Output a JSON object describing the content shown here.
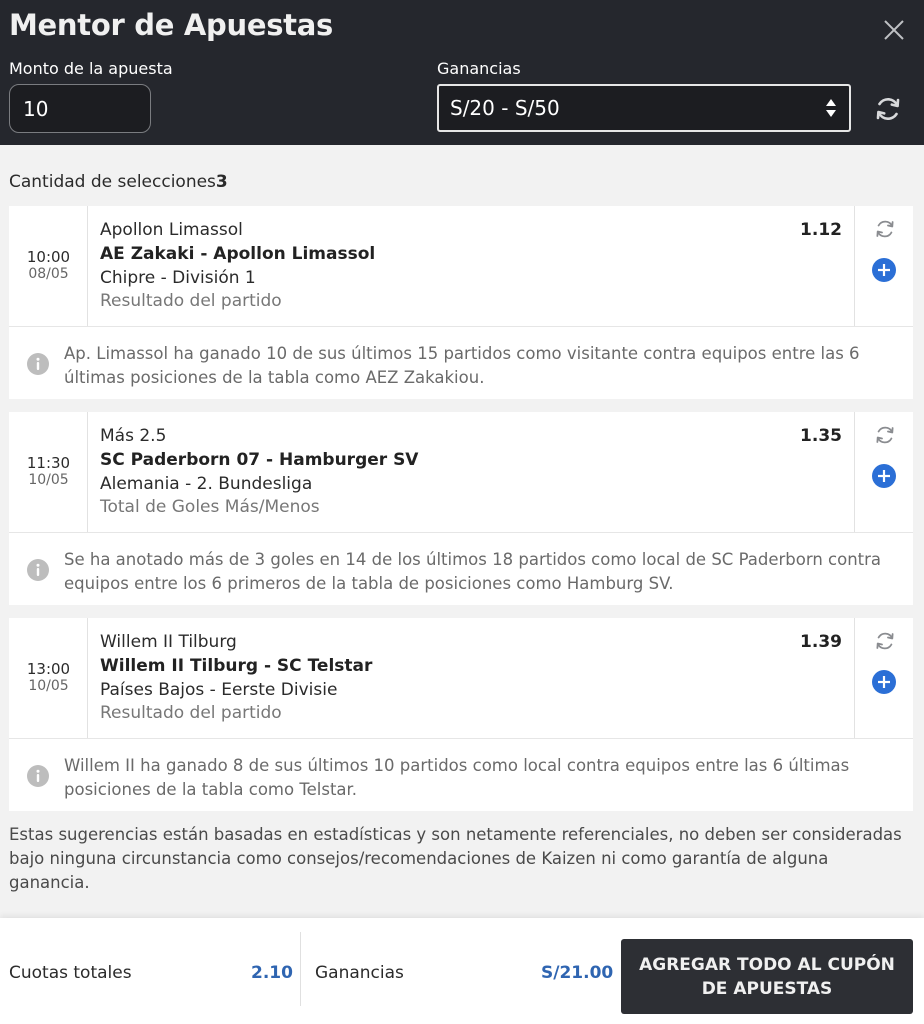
{
  "header": {
    "title": "Mentor de Apuestas",
    "amount_label": "Monto de la apuesta",
    "amount_value": "10",
    "gain_label": "Ganancias",
    "gain_selected": "S/20 - S/50"
  },
  "selection_count": {
    "label": "Cantidad de selecciones",
    "value": "3"
  },
  "bets": [
    {
      "time": "10:00",
      "date": "08/05",
      "selection": "Apollon Limassol",
      "match": "AE Zakaki - Apollon Limassol",
      "league": "Chipre - División 1",
      "market": "Resultado del partido",
      "odd": "1.12",
      "tip": "Ap. Limassol ha ganado 10 de sus últimos 15 partidos como visitante contra equipos entre las 6 últimas posiciones de la tabla como AEZ Zakakiou."
    },
    {
      "time": "11:30",
      "date": "10/05",
      "selection": "Más 2.5",
      "match": "SC Paderborn 07 - Hamburger SV",
      "league": "Alemania - 2. Bundesliga",
      "market": "Total de Goles Más/Menos",
      "odd": "1.35",
      "tip": "Se ha anotado más de 3 goles en 14 de los últimos 18 partidos como local de SC Paderborn contra equipos entre los 6 primeros de la tabla de posiciones como Hamburg SV."
    },
    {
      "time": "13:00",
      "date": "10/05",
      "selection": "Willem II Tilburg",
      "match": "Willem II Tilburg - SC Telstar",
      "league": "Países Bajos - Eerste Divisie",
      "market": "Resultado del partido",
      "odd": "1.39",
      "tip": "Willem II ha ganado 8 de sus últimos 10 partidos como local contra equipos entre las 6 últimas posiciones de la tabla como Telstar."
    }
  ],
  "disclaimer": "Estas sugerencias están basadas en estadísticas y son netamente referenciales, no deben ser consideradas bajo ninguna circunstancia como consejos/recomendaciones de Kaizen ni como garantía de alguna ganancia.",
  "footer": {
    "odds_label": "Cuotas totales",
    "odds_value": "2.10",
    "gain_label": "Ganancias",
    "gain_value": "S/21.00",
    "cta_label": "AGREGAR TODO AL CUPÓN DE APUESTAS"
  },
  "icons": {
    "close": "close-icon",
    "select_arrows": "sort-arrows-icon",
    "refresh": "refresh-icon",
    "swap": "swap-icon",
    "add": "plus-circle-icon",
    "info": "info-icon"
  },
  "colors": {
    "header_bg": "#25272d",
    "accent_blue": "#2f65b1",
    "plus_blue": "#2b6fd6",
    "cta_bg": "#2d2f34"
  }
}
